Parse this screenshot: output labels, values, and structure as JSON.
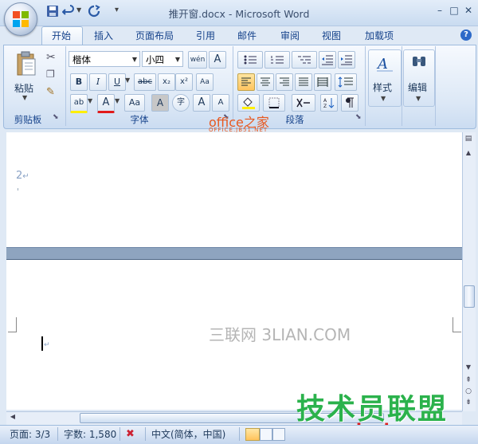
{
  "window": {
    "title": "推开窗.docx - Microsoft Word",
    "min": "–",
    "max": "□",
    "close": "✕"
  },
  "tabs": [
    {
      "label": "开始",
      "active": true
    },
    {
      "label": "插入"
    },
    {
      "label": "页面布局"
    },
    {
      "label": "引用"
    },
    {
      "label": "邮件"
    },
    {
      "label": "审阅"
    },
    {
      "label": "视图"
    },
    {
      "label": "加载项"
    }
  ],
  "help_label": "?",
  "ribbon": {
    "clipboard": {
      "paste_label": "粘贴",
      "group_label": "剪贴板"
    },
    "font": {
      "font_name": "楷体",
      "font_size": "小四",
      "wen_label": "wén",
      "a_label": "A",
      "bold": "B",
      "italic": "I",
      "underline": "U",
      "strike": "abc",
      "subscript": "x₂",
      "superscript": "x²",
      "clear": "Aa",
      "highlight": "ab",
      "font_color": "A",
      "change_case": "Aa",
      "shade": "A",
      "enclose": "字",
      "grow": "A",
      "shrink": "A",
      "group_label": "字体"
    },
    "paragraph": {
      "group_label": "段落"
    },
    "styles": {
      "label": "样式"
    },
    "editing": {
      "label": "编辑"
    }
  },
  "watermarks": {
    "office_main": "office之家",
    "office_sub": "OFFICE.JB51.NET",
    "sanlian": "三联网 3LIAN.COM",
    "jsgho_main": "技术员联盟",
    "jsgho_url": "www.jsgho.com"
  },
  "document": {
    "page_number_text": "2"
  },
  "status": {
    "page": "页面: 3/3",
    "words": "字数: 1,580",
    "language": "中文(简体，中国)"
  },
  "colors": {
    "ribbon_text": "#15428b",
    "office_orange": "#e8581f",
    "jsgho_green": "#2bb24c"
  }
}
